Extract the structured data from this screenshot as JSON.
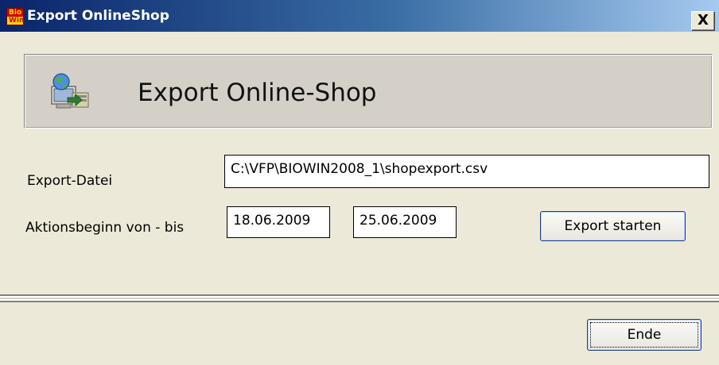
{
  "window": {
    "title": "Export OnlineShop",
    "app_icon_line1": "Bio",
    "app_icon_line2": "Win",
    "close_label": "X"
  },
  "header": {
    "title": "Export Online-Shop",
    "icon": "export-globe-icon"
  },
  "form": {
    "export_file_label": "Export-Datei",
    "export_file_value": "C:\\VFP\\BIOWIN2008_1\\shopexport.csv",
    "date_range_label": "Aktionsbeginn von - bis",
    "date_from_value": "18.06.2009",
    "date_to_value": "25.06.2009",
    "start_export_label": "Export starten"
  },
  "footer": {
    "end_label": "Ende"
  },
  "colors": {
    "window_bg": "#ece9d8",
    "titlebar_start": "#0a246a",
    "titlebar_end": "#a6caf0",
    "header_panel_bg": "#d4d0c8"
  }
}
